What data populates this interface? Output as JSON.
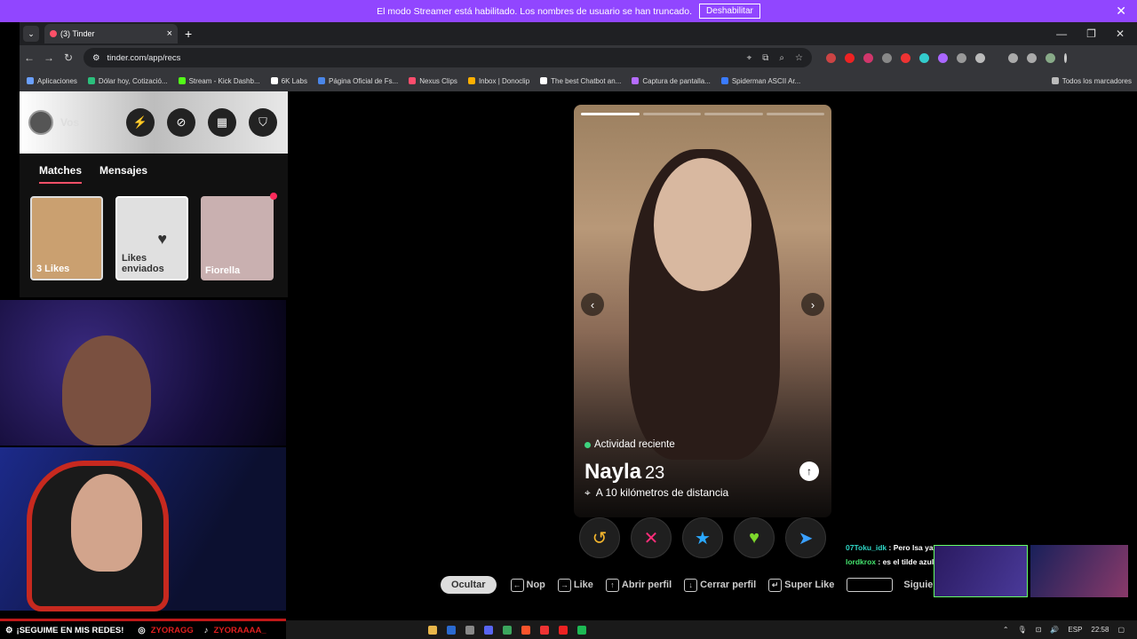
{
  "streamer_banner": {
    "message": "El modo Streamer está habilitado. Los nombres de usuario se han truncado.",
    "button": "Deshabilitar",
    "close": "✕"
  },
  "browser": {
    "tab_title": "(3) Tinder",
    "tab_close": "×",
    "new_tab": "+",
    "tab_dropdown": "⌄",
    "url": "tinder.com/app/recs",
    "window_controls": [
      "—",
      "❐",
      "✕"
    ],
    "bookmarks": [
      {
        "label": "Aplicaciones",
        "color": "#6aa0ff"
      },
      {
        "label": "Dólar hoy, Cotizació...",
        "color": "#2bbf7c"
      },
      {
        "label": "Stream - Kick Dashb...",
        "color": "#53fc18"
      },
      {
        "label": "6K Labs",
        "color": "#ffffff"
      },
      {
        "label": "Página Oficial de Fs...",
        "color": "#4a86e8"
      },
      {
        "label": "Nexus Clips",
        "color": "#ff4d6d"
      },
      {
        "label": "Inbox | Donoclip",
        "color": "#ffb000"
      },
      {
        "label": "The best Chatbot an...",
        "color": "#ffffff"
      },
      {
        "label": "Captura de pantalla...",
        "color": "#b56cff"
      },
      {
        "label": "Spiderman ASCII Ar...",
        "color": "#3a7bff"
      }
    ],
    "all_bookmarks": "Todos los marcadores"
  },
  "sidebar": {
    "user_label": "Vos",
    "tabs": [
      "Matches",
      "Mensajes"
    ],
    "matches": [
      {
        "label": "3 Likes",
        "bg": "#caa070"
      },
      {
        "label": "Likes enviados",
        "bg": "#e0e0e0"
      },
      {
        "label": "Fiorella",
        "bg": "#c9b0b0"
      }
    ]
  },
  "profile": {
    "activity": "Actividad reciente",
    "name": "Nayla",
    "age": "23",
    "distance": "A 10 kilómetros de distancia",
    "photo_count": 4,
    "current_photo": 1
  },
  "actions": [
    {
      "name": "rewind",
      "glyph": "↺",
      "color": "#f5b62d"
    },
    {
      "name": "nope",
      "glyph": "✕",
      "color": "#ff2d7a"
    },
    {
      "name": "super-like",
      "glyph": "★",
      "color": "#2aa8ff"
    },
    {
      "name": "like",
      "glyph": "♥",
      "color": "#7dd82c"
    },
    {
      "name": "boost",
      "glyph": "➤",
      "color": "#3aa0ff"
    }
  ],
  "hints": {
    "hide": "Ocultar",
    "items": [
      {
        "key": "←",
        "label": "Nop"
      },
      {
        "key": "→",
        "label": "Like"
      },
      {
        "key": "↑",
        "label": "Abrir perfil"
      },
      {
        "key": "↓",
        "label": "Cerrar perfil"
      },
      {
        "key": "↵",
        "label": "Super Like"
      }
    ],
    "next": "Siguie"
  },
  "chat": [
    {
      "user": "07Toku_idk",
      "msg": "Pero lsa ya sos lesbiana"
    },
    {
      "user": "lordkrox",
      "msg": "es el tilde azul al lado del nombre"
    }
  ],
  "social": {
    "label": "¡SEGUIME EN MIS REDES!",
    "handle1": "ZYORAGG",
    "handle2": "ZYORAAAA_"
  },
  "taskbar": {
    "lang": "ESP",
    "time": "22:58"
  }
}
